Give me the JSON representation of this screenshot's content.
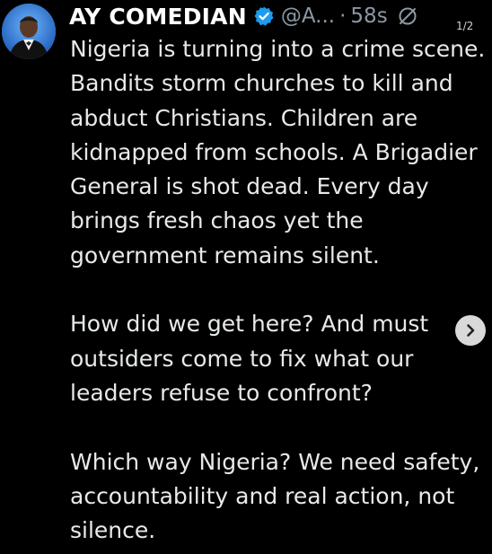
{
  "tweet": {
    "display_name": "AY COMEDIAN",
    "handle": "@A...",
    "separator": "·",
    "time": "58s",
    "page_counter": "1/2",
    "paragraphs": [
      "Nigeria is turning into a crime scene. Bandits storm churches to kill and abduct Christians. Children are kidnapped from schools. A Brigadier General is shot dead. Every day brings fresh chaos yet the government remains silent.",
      "How did we get here? And must outsiders come to fix what our leaders refuse to confront?",
      "Which way Nigeria? We need safety, accountability and real action, not silence."
    ]
  },
  "icons": {
    "verified": "verified-badge-icon",
    "muted": "muted-icon",
    "next": "chevron-right-icon"
  },
  "colors": {
    "background": "#000000",
    "text": "#e7e9ea",
    "secondary_text": "#8b98a5",
    "verified": "#1d9bf0",
    "avatar_bg": "#3b7fd0"
  }
}
